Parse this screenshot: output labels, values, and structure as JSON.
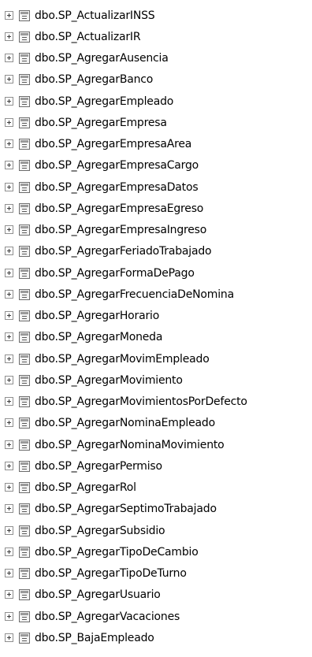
{
  "tree": {
    "items": [
      {
        "label": "dbo.SP_ActualizarINSS",
        "icon": "stored-procedure-icon"
      },
      {
        "label": "dbo.SP_ActualizarIR",
        "icon": "stored-procedure-icon"
      },
      {
        "label": "dbo.SP_AgregarAusencia",
        "icon": "stored-procedure-icon"
      },
      {
        "label": "dbo.SP_AgregarBanco",
        "icon": "stored-procedure-icon"
      },
      {
        "label": "dbo.SP_AgregarEmpleado",
        "icon": "stored-procedure-icon"
      },
      {
        "label": "dbo.SP_AgregarEmpresa",
        "icon": "stored-procedure-icon"
      },
      {
        "label": "dbo.SP_AgregarEmpresaArea",
        "icon": "stored-procedure-icon"
      },
      {
        "label": "dbo.SP_AgregarEmpresaCargo",
        "icon": "stored-procedure-icon"
      },
      {
        "label": "dbo.SP_AgregarEmpresaDatos",
        "icon": "stored-procedure-icon"
      },
      {
        "label": "dbo.SP_AgregarEmpresaEgreso",
        "icon": "stored-procedure-icon"
      },
      {
        "label": "dbo.SP_AgregarEmpresaIngreso",
        "icon": "stored-procedure-icon"
      },
      {
        "label": "dbo.SP_AgregarFeriadoTrabajado",
        "icon": "stored-procedure-icon"
      },
      {
        "label": "dbo.SP_AgregarFormaDePago",
        "icon": "stored-procedure-icon"
      },
      {
        "label": "dbo.SP_AgregarFrecuenciaDeNomina",
        "icon": "stored-procedure-icon"
      },
      {
        "label": "dbo.SP_AgregarHorario",
        "icon": "stored-procedure-icon"
      },
      {
        "label": "dbo.SP_AgregarMoneda",
        "icon": "stored-procedure-icon"
      },
      {
        "label": "dbo.SP_AgregarMovimEmpleado",
        "icon": "stored-procedure-icon"
      },
      {
        "label": "dbo.SP_AgregarMovimiento",
        "icon": "stored-procedure-icon"
      },
      {
        "label": "dbo.SP_AgregarMovimientosPorDefecto",
        "icon": "stored-procedure-icon"
      },
      {
        "label": "dbo.SP_AgregarNominaEmpleado",
        "icon": "stored-procedure-icon"
      },
      {
        "label": "dbo.SP_AgregarNominaMovimiento",
        "icon": "stored-procedure-icon"
      },
      {
        "label": "dbo.SP_AgregarPermiso",
        "icon": "stored-procedure-icon"
      },
      {
        "label": "dbo.SP_AgregarRol",
        "icon": "stored-procedure-icon"
      },
      {
        "label": "dbo.SP_AgregarSeptimoTrabajado",
        "icon": "stored-procedure-icon"
      },
      {
        "label": "dbo.SP_AgregarSubsidio",
        "icon": "stored-procedure-icon"
      },
      {
        "label": "dbo.SP_AgregarTipoDeCambio",
        "icon": "stored-procedure-icon"
      },
      {
        "label": "dbo.SP_AgregarTipoDeTurno",
        "icon": "stored-procedure-icon"
      },
      {
        "label": "dbo.SP_AgregarUsuario",
        "icon": "stored-procedure-icon"
      },
      {
        "label": "dbo.SP_AgregarVacaciones",
        "icon": "stored-procedure-icon"
      },
      {
        "label": "dbo.SP_BajaEmpleado",
        "icon": "stored-procedure-icon"
      }
    ],
    "expander_icon": "expand-plus-icon",
    "colors": {
      "text": "#000000",
      "background": "#ffffff",
      "expander_border": "#8f8f8f"
    }
  }
}
